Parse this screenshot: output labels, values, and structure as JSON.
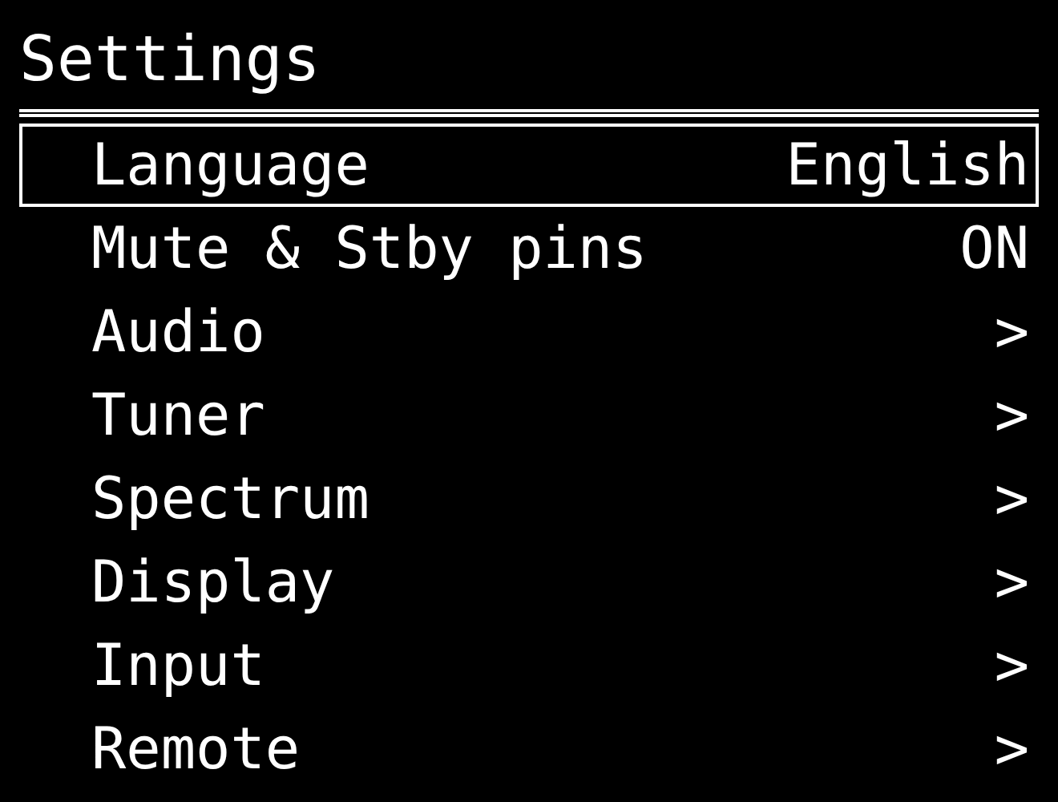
{
  "title": "Settings",
  "items": [
    {
      "label": "Language",
      "value": "English",
      "selected": true
    },
    {
      "label": "Mute & Stby pins",
      "value": "ON",
      "selected": false
    },
    {
      "label": "Audio",
      "value": ">",
      "selected": false
    },
    {
      "label": "Tuner",
      "value": ">",
      "selected": false
    },
    {
      "label": "Spectrum",
      "value": ">",
      "selected": false
    },
    {
      "label": "Display",
      "value": ">",
      "selected": false
    },
    {
      "label": "Input",
      "value": ">",
      "selected": false
    },
    {
      "label": "Remote",
      "value": ">",
      "selected": false
    }
  ]
}
